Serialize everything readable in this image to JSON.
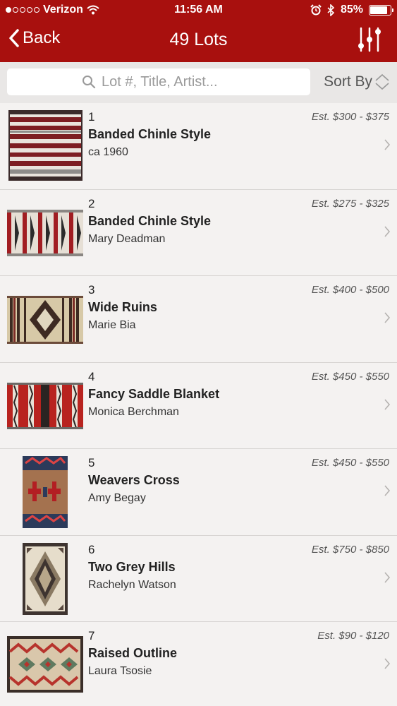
{
  "status": {
    "carrier": "Verizon",
    "time": "11:56 AM",
    "battery": "85%",
    "battery_level": 0.85
  },
  "nav": {
    "back_label": "Back",
    "title": "49 Lots"
  },
  "search": {
    "placeholder": "Lot #, Title, Artist..."
  },
  "sort": {
    "label": "Sort By"
  },
  "lots": [
    {
      "number": "1",
      "title": "Banded Chinle Style",
      "subtitle": "ca 1960",
      "estimate": "Est. $300 - $375"
    },
    {
      "number": "2",
      "title": "Banded Chinle Style",
      "subtitle": "Mary Deadman",
      "estimate": "Est. $275 - $325"
    },
    {
      "number": "3",
      "title": "Wide Ruins",
      "subtitle": "Marie Bia",
      "estimate": "Est. $400 - $500"
    },
    {
      "number": "4",
      "title": "Fancy Saddle Blanket",
      "subtitle": "Monica Berchman",
      "estimate": "Est. $450 - $550"
    },
    {
      "number": "5",
      "title": "Weavers Cross",
      "subtitle": "Amy Begay",
      "estimate": "Est. $450 - $550"
    },
    {
      "number": "6",
      "title": "Two Grey Hills",
      "subtitle": "Rachelyn Watson",
      "estimate": "Est. $750 - $850"
    },
    {
      "number": "7",
      "title": "Raised Outline",
      "subtitle": "Laura Tsosie",
      "estimate": "Est. $90 - $120"
    }
  ],
  "colors": {
    "header_bg": "#a8100e",
    "row_bg": "#f4f2f1",
    "search_bg": "#e9e7e6"
  }
}
